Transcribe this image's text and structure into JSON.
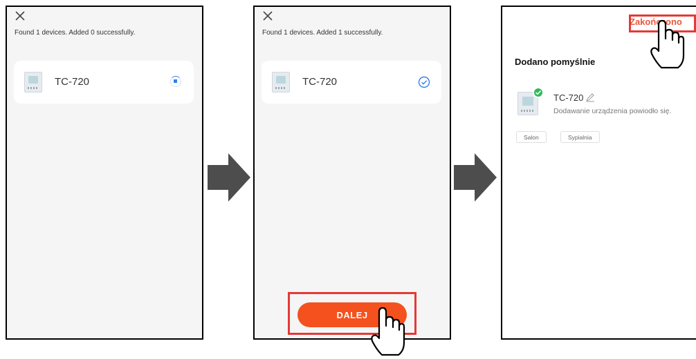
{
  "screen1": {
    "found_text": "Found 1 devices. Added 0 successfully.",
    "device_name": "TC-720",
    "status_icon": "loading-spinner"
  },
  "screen2": {
    "found_text": "Found 1 devices. Added 1 successfully.",
    "device_name": "TC-720",
    "status_icon": "check-circle",
    "next_button": "DALEJ"
  },
  "screen3": {
    "finish_button": "Zakończono",
    "title": "Dodano pomyślnie",
    "device_name": "TC-720",
    "subtitle": "Dodawanie urządzenia powiodło się.",
    "rooms": [
      "Salon",
      "Sypialnia"
    ]
  },
  "colors": {
    "accent": "#f4511e",
    "highlight": "#e53935",
    "success": "#2fb85a",
    "link": "#2f80ed"
  }
}
